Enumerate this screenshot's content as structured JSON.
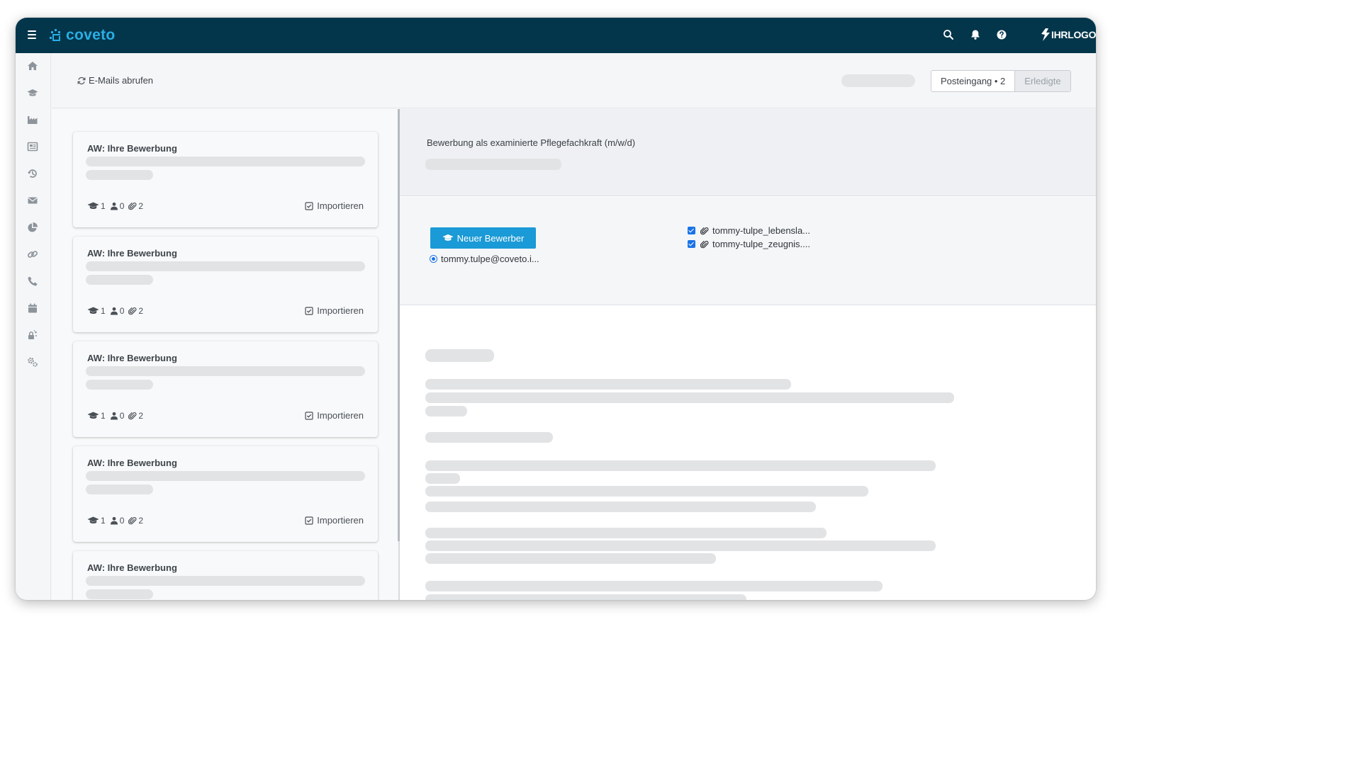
{
  "app": {
    "brand": "coveto",
    "customer_logo": "IHRLOGO",
    "accent": "#29aee6",
    "topbar_color": "#04364b",
    "primary_button_color": "#1a9ad6"
  },
  "topbar": {
    "icons": [
      "menu-icon",
      "search-icon",
      "bell-icon",
      "help-icon"
    ]
  },
  "sidebar": {
    "items": [
      {
        "icon": "home-icon"
      },
      {
        "icon": "graduation-cap-icon"
      },
      {
        "icon": "industry-icon"
      },
      {
        "icon": "newspaper-icon"
      },
      {
        "icon": "history-icon"
      },
      {
        "icon": "envelope-icon"
      },
      {
        "icon": "pie-chart-icon"
      },
      {
        "icon": "link-icon"
      },
      {
        "icon": "phone-icon"
      },
      {
        "icon": "calendar-icon"
      },
      {
        "icon": "user-lock-icon"
      },
      {
        "icon": "cogs-icon"
      }
    ]
  },
  "toolbar": {
    "fetch_label": "E-Mails abrufen",
    "tabs": [
      {
        "label": "Posteingang • 2",
        "active": true
      },
      {
        "label": "Erledigte",
        "active": false
      }
    ]
  },
  "mails": [
    {
      "subject": "AW: Ihre Bewerbung",
      "applicants": "1",
      "contacts": "0",
      "attachments": "2",
      "import_label": "Importieren"
    },
    {
      "subject": "AW: Ihre Bewerbung",
      "applicants": "1",
      "contacts": "0",
      "attachments": "2",
      "import_label": "Importieren"
    },
    {
      "subject": "AW: Ihre Bewerbung",
      "applicants": "1",
      "contacts": "0",
      "attachments": "2",
      "import_label": "Importieren"
    },
    {
      "subject": "AW: Ihre Bewerbung",
      "applicants": "1",
      "contacts": "0",
      "attachments": "2",
      "import_label": "Importieren"
    },
    {
      "subject": "AW: Ihre Bewerbung",
      "applicants": "",
      "contacts": "",
      "attachments": "",
      "import_label": ""
    }
  ],
  "detail": {
    "subject": "Bewerbung als examinierte Pflegefachkraft (m/w/d)",
    "new_applicant_label": "Neuer Bewerber",
    "sender": "tommy.tulpe@coveto.i...",
    "attachments": [
      "tommy-tulpe_lebensla...",
      "tommy-tulpe_zeugnis...."
    ]
  }
}
